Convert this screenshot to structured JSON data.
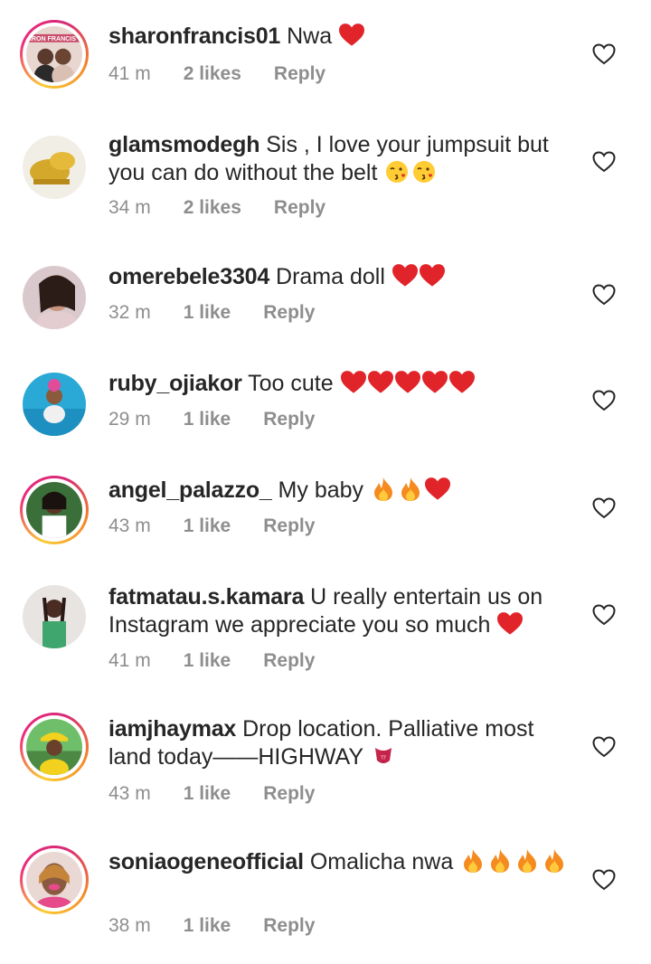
{
  "colors": {
    "text": "#262626",
    "meta": "#8e8e8e",
    "heart": "#e0242a"
  },
  "comments": [
    {
      "username": "sharonfrancis01",
      "text": "Nwa",
      "emojis": [
        "red-heart"
      ],
      "time": "41 m",
      "likes": "2 likes",
      "reply": "Reply",
      "story_ring": true,
      "avatar_banner": "ARON FRANCIS T"
    },
    {
      "username": "glamsmodegh",
      "text": "Sis , I love your jumpsuit but you can do without the belt",
      "emojis": [
        "kissing-face",
        "kissing-face"
      ],
      "time": "34 m",
      "likes": "2 likes",
      "reply": "Reply",
      "story_ring": false
    },
    {
      "username": "omerebele3304",
      "text": "Drama doll",
      "emojis": [
        "red-heart",
        "red-heart"
      ],
      "time": "32 m",
      "likes": "1 like",
      "reply": "Reply",
      "story_ring": false
    },
    {
      "username": "ruby_ojiakor",
      "text": "Too cute",
      "emojis": [
        "red-heart",
        "red-heart",
        "red-heart",
        "red-heart",
        "red-heart"
      ],
      "time": "29 m",
      "likes": "1 like",
      "reply": "Reply",
      "story_ring": false
    },
    {
      "username": "angel_palazzo_",
      "text": "My baby",
      "emojis": [
        "fire",
        "fire",
        "red-heart"
      ],
      "time": "43 m",
      "likes": "1 like",
      "reply": "Reply",
      "story_ring": true
    },
    {
      "username": "fatmatau.s.kamara",
      "text": "U really entertain us on Instagram we appreciate you so much",
      "emojis": [
        "red-heart"
      ],
      "time": "41 m",
      "likes": "1 like",
      "reply": "Reply",
      "story_ring": false
    },
    {
      "username": "iamjhaymax",
      "text": "Drop location.  Palliative most land today——HIGHWAY",
      "emojis": [
        "tongue-face"
      ],
      "time": "43 m",
      "likes": "1 like",
      "reply": "Reply",
      "story_ring": true
    },
    {
      "username": "soniaogeneofficial",
      "text": "Omalicha nwa",
      "emojis": [
        "fire",
        "fire",
        "fire",
        "fire"
      ],
      "time": "38 m",
      "likes": "1 like",
      "reply": "Reply",
      "story_ring": true
    }
  ]
}
